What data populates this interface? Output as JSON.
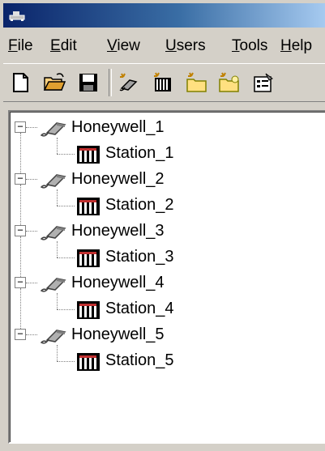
{
  "window": {
    "title_icon": "app-icon"
  },
  "menu": {
    "items": [
      {
        "accel": "F",
        "rest": "ile"
      },
      {
        "accel": "E",
        "rest": "dit"
      },
      {
        "accel": "V",
        "rest": "iew"
      },
      {
        "accel": "U",
        "rest": "sers"
      },
      {
        "accel": "T",
        "rest": "ools"
      },
      {
        "accel": "H",
        "rest": "elp"
      }
    ]
  },
  "toolbar": {
    "buttons": [
      "new-file-icon",
      "open-folder-icon",
      "save-disk-icon",
      "add-device-icon",
      "add-station-icon",
      "new-group-icon",
      "open-group-icon",
      "properties-icon"
    ]
  },
  "tree": {
    "devices": [
      {
        "label": "Honeywell_1",
        "station": "Station_1"
      },
      {
        "label": "Honeywell_2",
        "station": "Station_2"
      },
      {
        "label": "Honeywell_3",
        "station": "Station_3"
      },
      {
        "label": "Honeywell_4",
        "station": "Station_4"
      },
      {
        "label": "Honeywell_5",
        "station": "Station_5"
      }
    ],
    "expander_symbol": "−"
  }
}
